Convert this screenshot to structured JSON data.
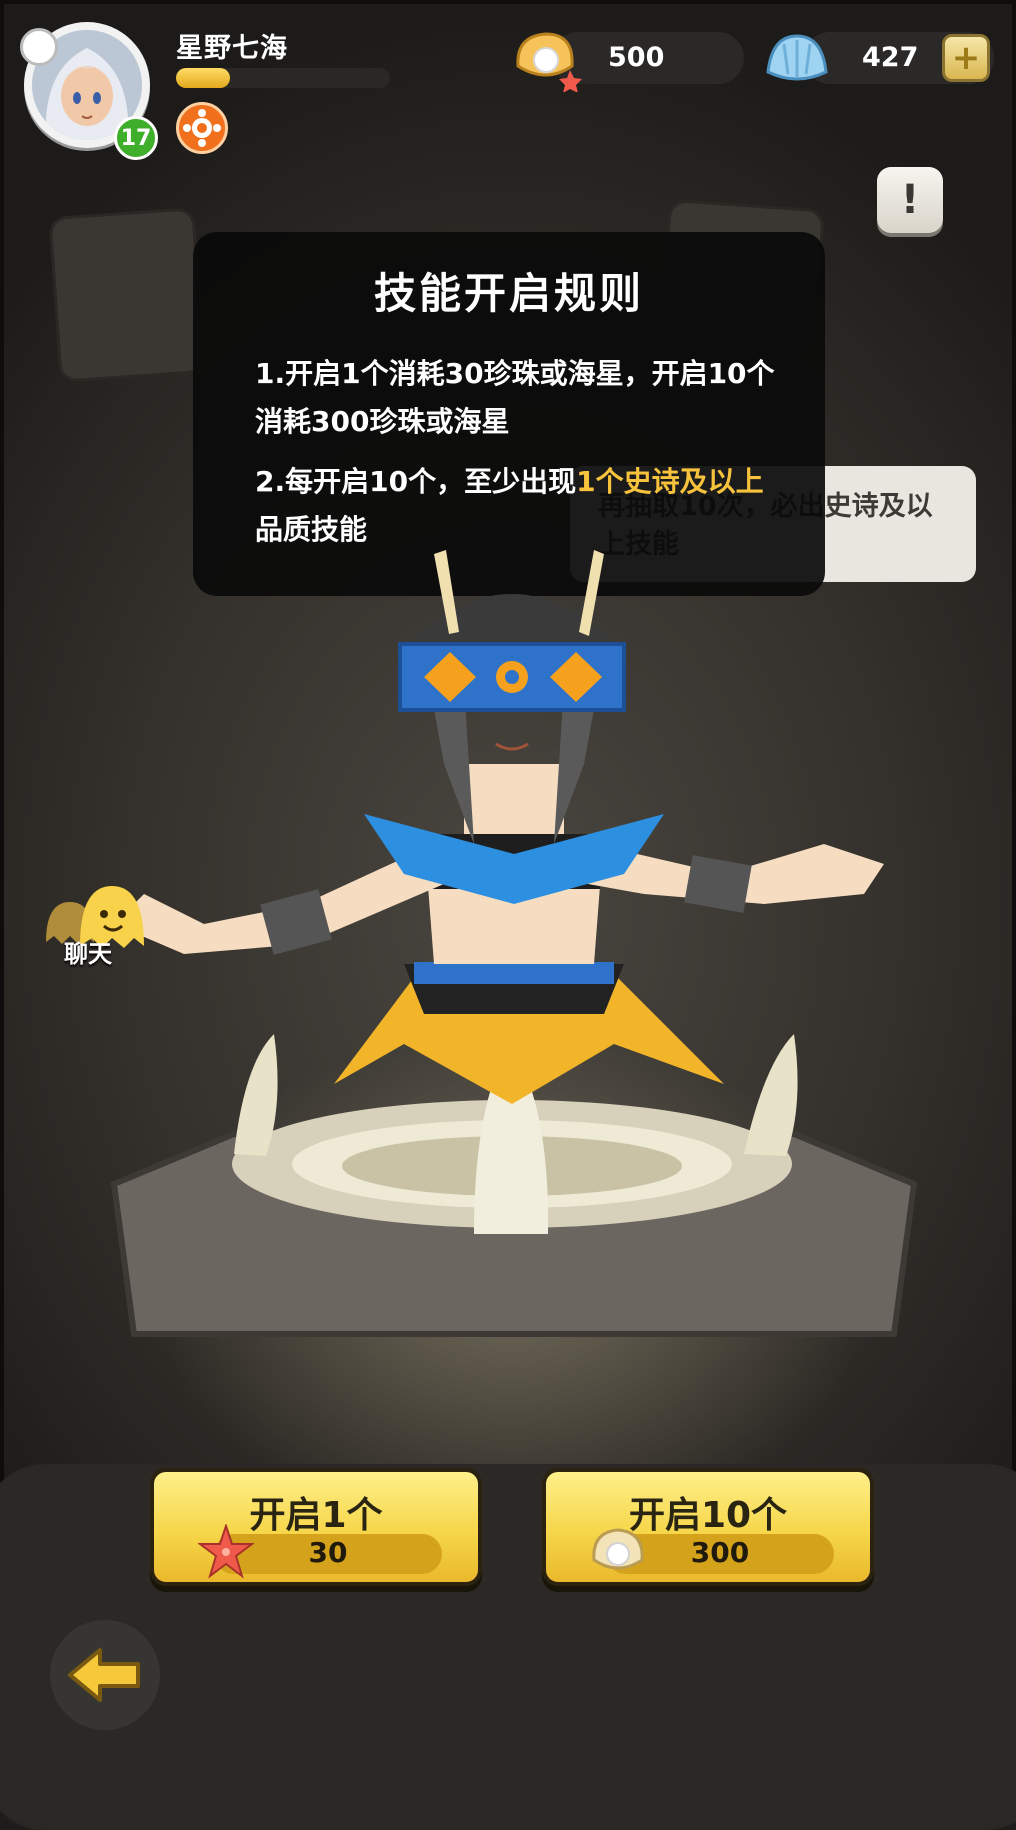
{
  "player": {
    "name": "星野七海",
    "level": "17",
    "xp_fraction": 0.25
  },
  "resources": {
    "pearls": "500",
    "starfish_shells": "427"
  },
  "rules": {
    "title": "技能开启规则",
    "rule1": "1.开启1个消耗30珍珠或海星，开启10个消耗300珍珠或海星",
    "rule2_prefix": "2.每开启10个，至少出现",
    "rule2_highlight": "1个史诗及以上",
    "rule2_suffix": "品质技能"
  },
  "hint": {
    "text": "再抽取10次，必出史诗及以上技能"
  },
  "chat": {
    "label": "聊天"
  },
  "actions": {
    "open_one": {
      "label": "开启1个",
      "cost": "30",
      "currency_icon": "starfish-icon"
    },
    "open_ten": {
      "label": "开启10个",
      "cost": "300",
      "currency_icon": "pearl-icon"
    }
  },
  "colors": {
    "highlight": "#f7c23c",
    "button_gold": "#f6d64a",
    "level_green": "#3fae2a"
  }
}
